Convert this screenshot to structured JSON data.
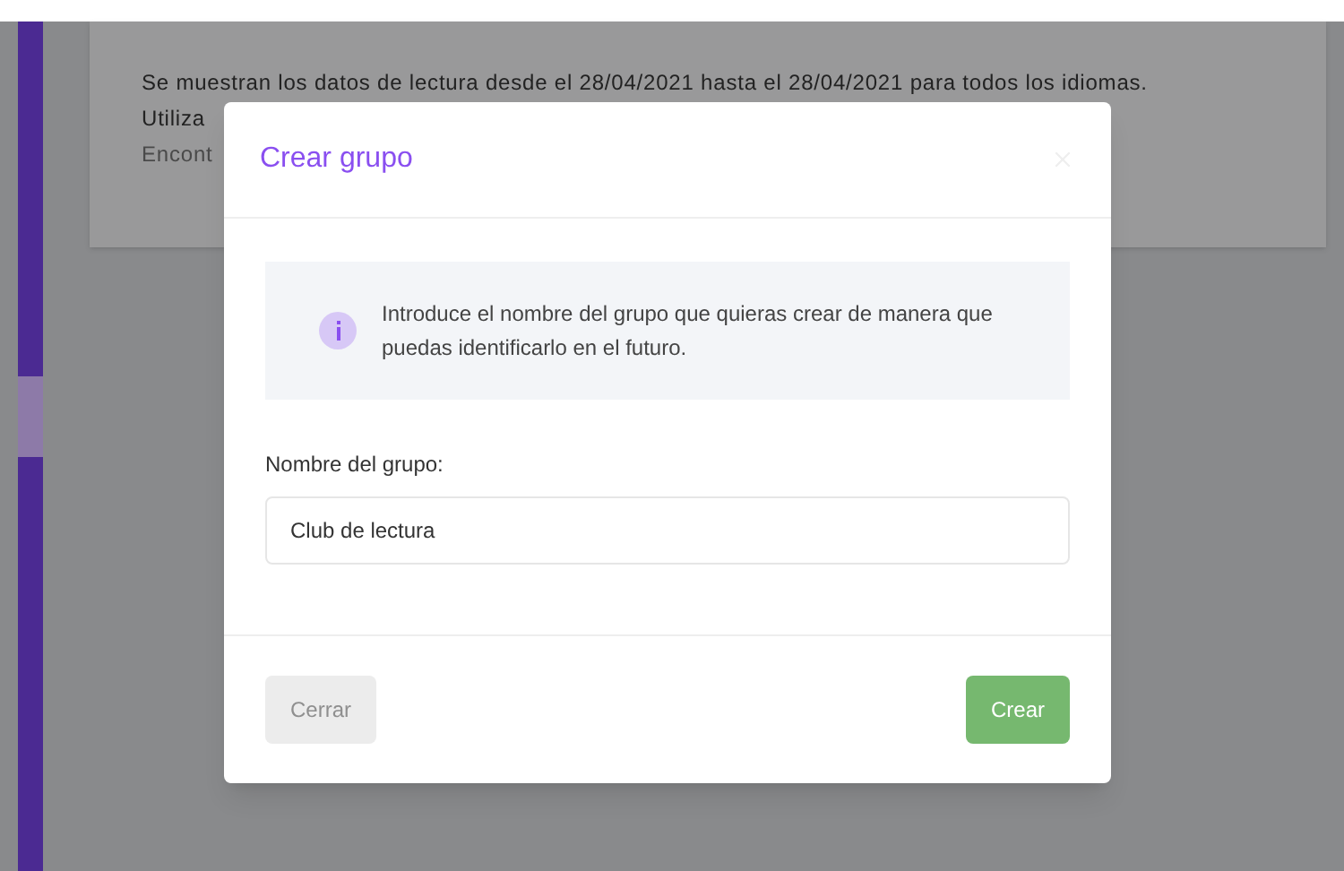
{
  "background_card": {
    "lines": [
      "Se muestran los datos de lectura desde el 28/04/2021 hasta el 28/04/2021 para todos los idiomas.",
      "Utiliza",
      "Encont"
    ]
  },
  "dialog": {
    "title": "Crear grupo",
    "info": "Introduce el nombre del grupo que quieras crear de manera que puedas identificarlo en el futuro.",
    "field": {
      "label": "Nombre del grupo:",
      "value": "Club de lectura"
    },
    "buttons": [
      {
        "label": "Cerrar",
        "kind": "secondary",
        "disabled": true
      },
      {
        "label": "Crear",
        "kind": "primary",
        "disabled": false
      }
    ]
  }
}
